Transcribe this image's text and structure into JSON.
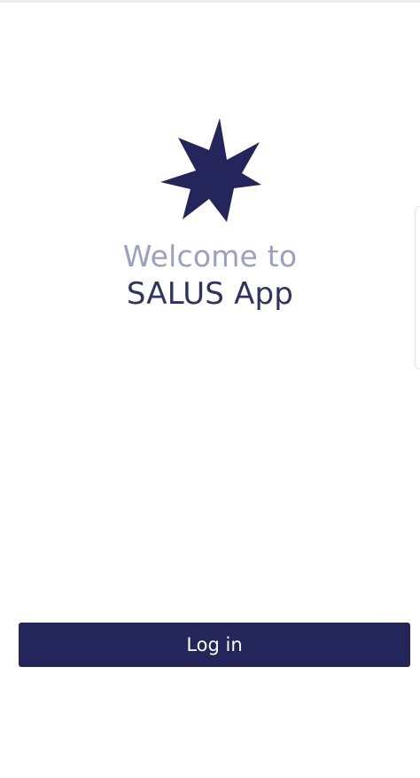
{
  "brand": {
    "primary_color": "#23255b",
    "muted_text_color": "#9aa0bf",
    "logo_icon": "seven-point-star-icon"
  },
  "welcome": {
    "line1": "Welcome to",
    "line2": "SALUS App"
  },
  "actions": {
    "login_label": "Log in"
  }
}
